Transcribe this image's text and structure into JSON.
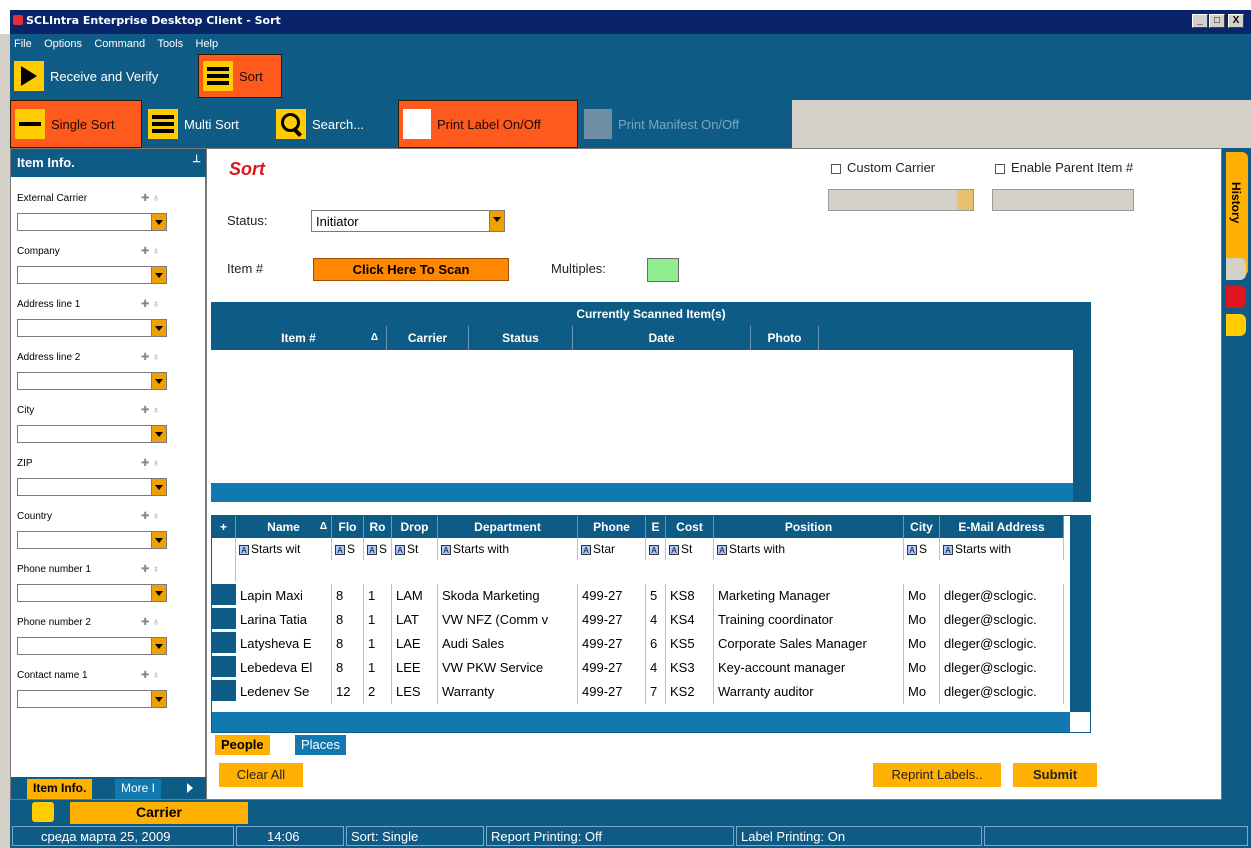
{
  "window": {
    "title": "SCLIntra Enterprise Desktop Client - Sort",
    "min": "_",
    "max": "□",
    "close": "X"
  },
  "menu": [
    "File",
    "Options",
    "Command",
    "Tools",
    "Help"
  ],
  "toolbar1": {
    "receive": "Receive and Verify",
    "sort": "Sort"
  },
  "toolbar2": {
    "single_sort": "Single Sort",
    "multi_sort": "Multi Sort",
    "search": "Search...",
    "print_label": "Print Label On/Off",
    "print_manifest": "Print Manifest On/Off"
  },
  "left_panel": {
    "title": "Item Info.",
    "fields": [
      "External Carrier",
      "Company",
      "Address line 1",
      "Address line 2",
      "City",
      "ZIP",
      "Country",
      "Phone number 1",
      "Phone number 2",
      "Contact name 1"
    ],
    "tabs": {
      "item_info": "Item Info.",
      "more": "More I"
    }
  },
  "main": {
    "title": "Sort",
    "custom_carrier": "Custom Carrier",
    "enable_parent": "Enable Parent Item #",
    "status_label": "Status:",
    "status_value": "Initiator",
    "item_label": "Item #",
    "scan_button": "Click Here To Scan",
    "multiples_label": "Multiples:",
    "multiples_color": "#90ee90"
  },
  "scanned": {
    "title": "Currently Scanned Item(s)",
    "columns": [
      "Item #",
      "Carrier",
      "Status",
      "Date",
      "Photo"
    ],
    "sort_glyph": "Δ"
  },
  "people": {
    "columns": [
      "Name",
      "Flo",
      "Ro",
      "Drop",
      "Department",
      "Phone",
      "E",
      "Cost",
      "Position",
      "City",
      "E-Mail Address"
    ],
    "add_glyph": "+",
    "filters": [
      "Starts wit",
      "S",
      "S",
      "St",
      "Starts with",
      "Star",
      "",
      "St",
      "Starts with",
      "S",
      "Starts with"
    ],
    "filter_icon_letter": "A",
    "rows": [
      [
        "Lapin Maxi",
        "8",
        "1",
        "LAM",
        "Skoda Marketing",
        "499-27",
        "5",
        "KS8",
        "Marketing Manager",
        "Mo",
        "dleger@sclogic."
      ],
      [
        "Larina Tatia",
        "8",
        "1",
        "LAT",
        "VW NFZ (Comm v",
        "499-27",
        "4",
        "KS4",
        "Training coordinator",
        "Mo",
        "dleger@sclogic."
      ],
      [
        "Latysheva E",
        "8",
        "1",
        "LAE",
        "Audi Sales",
        "499-27",
        "6",
        "KS5",
        "Corporate Sales Manager",
        "Mo",
        "dleger@sclogic."
      ],
      [
        "Lebedeva El",
        "8",
        "1",
        "LEE",
        "VW PKW Service",
        "499-27",
        "4",
        "KS3",
        "Key-account manager",
        "Mo",
        "dleger@sclogic."
      ],
      [
        "Ledenev Se",
        "12",
        "2",
        "LES",
        "Warranty",
        "499-27",
        "7",
        "KS2",
        "Warranty auditor",
        "Mo",
        "dleger@sclogic."
      ]
    ],
    "tabs": {
      "people": "People",
      "places": "Places"
    }
  },
  "buttons": {
    "clear_all": "Clear All",
    "reprint": "Reprint Labels..",
    "submit": "Submit"
  },
  "carrier_tab": "Carrier",
  "right_rail": {
    "history": "History"
  },
  "status_bar": {
    "date": "среда марта 25, 2009",
    "time": "14:06",
    "mode": "Sort: Single",
    "report": "Report Printing: Off",
    "label": "Label Printing: On"
  }
}
